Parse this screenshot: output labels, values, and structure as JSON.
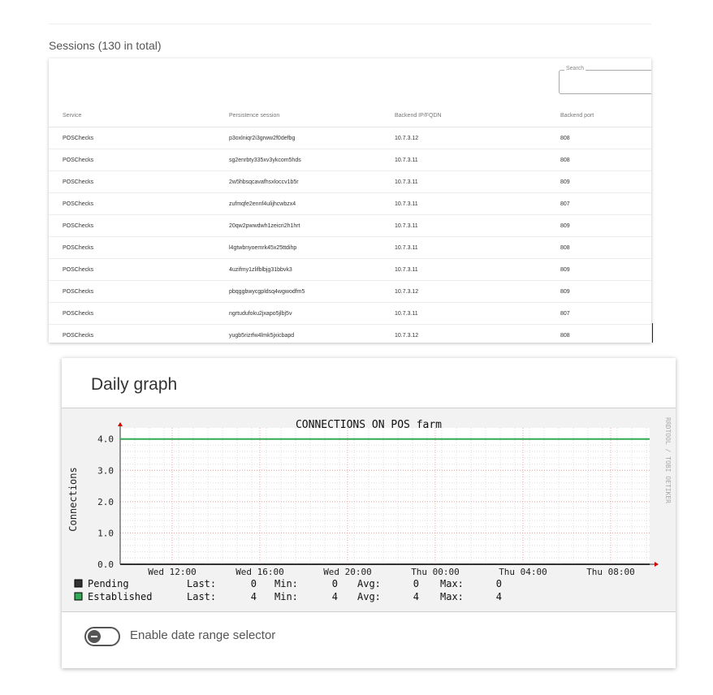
{
  "sessions": {
    "title": "Sessions (130 in total)",
    "search_label": "Search",
    "columns": [
      "Service",
      "Persistence session",
      "Backend IP/FQDN",
      "Backend port"
    ],
    "rows": [
      [
        "POSChecks",
        "p3oxlniqr2i3grww2f0defbg",
        "10.7.3.12",
        "808"
      ],
      [
        "POSChecks",
        "sg2enrbty335xv3ykcom5hds",
        "10.7.3.11",
        "808"
      ],
      [
        "POSChecks",
        "2w5hbsqcavafhsxloccv1b5r",
        "10.7.3.11",
        "809"
      ],
      [
        "POSChecks",
        "zufmqfe2ennf4ulijhcwbzx4",
        "10.7.3.11",
        "807"
      ],
      [
        "POSChecks",
        "20qw2pwwdwh1zeicri2h1hrt",
        "10.7.3.11",
        "809"
      ],
      [
        "POSChecks",
        "l4gtwbnyoemrk45x25ttdihp",
        "10.7.3.11",
        "808"
      ],
      [
        "POSChecks",
        "4uzifmy1zlifblbjg31bbvk3",
        "10.7.3.11",
        "809"
      ],
      [
        "POSChecks",
        "pbqggbwycgpldsq4wgwodfm5",
        "10.7.3.12",
        "809"
      ],
      [
        "POSChecks",
        "ngrtudufoku2jxapo5jlbj5v",
        "10.7.3.11",
        "807"
      ],
      [
        "POSChecks",
        "yugb5rizrfw4lmk5jxicbapd",
        "10.7.3.12",
        "808"
      ]
    ]
  },
  "graph": {
    "card_title": "Daily graph",
    "toggle_label": "Enable date range selector",
    "watermark": "RRDTOOL / TOBI OETIKER"
  },
  "chart_data": {
    "type": "line",
    "title": "CONNECTIONS ON POS farm",
    "ylabel": "Connections",
    "xlabel": "",
    "ylim": [
      0,
      4.2
    ],
    "y_ticks": [
      "0.0",
      "1.0",
      "2.0",
      "3.0",
      "4.0"
    ],
    "x_ticks": [
      "Wed 12:00",
      "Wed 16:00",
      "Wed 20:00",
      "Thu 00:00",
      "Thu 04:00",
      "Thu 08:00"
    ],
    "grid": true,
    "series": [
      {
        "name": "Pending",
        "color": "#333333",
        "values": [
          0,
          0,
          0,
          0,
          0,
          0,
          0
        ],
        "legend": {
          "last_label": "Last:",
          "last": "0",
          "min_label": "Min:",
          "min": "0",
          "avg_label": "Avg:",
          "avg": "0",
          "max_label": "Max:",
          "max": "0"
        }
      },
      {
        "name": "Established",
        "color": "#33aa55",
        "values": [
          4,
          4,
          4,
          4,
          4,
          4,
          4
        ],
        "legend": {
          "last_label": "Last:",
          "last": "4",
          "min_label": "Min:",
          "min": "4",
          "avg_label": "Avg:",
          "avg": "4",
          "max_label": "Max:",
          "max": "4"
        }
      }
    ]
  }
}
